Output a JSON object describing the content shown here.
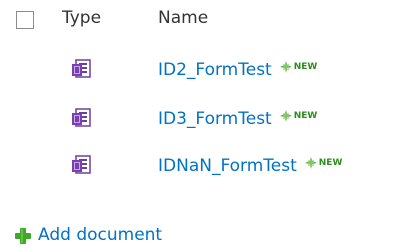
{
  "header": {
    "col_type": "Type",
    "col_name": "Name"
  },
  "documents": [
    {
      "name": "ID2_FormTest",
      "badge": "NEW",
      "icon": "infopath-form-icon"
    },
    {
      "name": "ID3_FormTest",
      "badge": "NEW",
      "icon": "infopath-form-icon"
    },
    {
      "name": "IDNaN_FormTest",
      "badge": "NEW",
      "icon": "infopath-form-icon"
    }
  ],
  "footer": {
    "add_label": "Add document"
  },
  "colors": {
    "link": "#0072c6",
    "header_text": "#333333",
    "new_badge": "#2e8b21",
    "add_plus": "#3fa72a",
    "icon_purple": "#6b3fa0"
  }
}
